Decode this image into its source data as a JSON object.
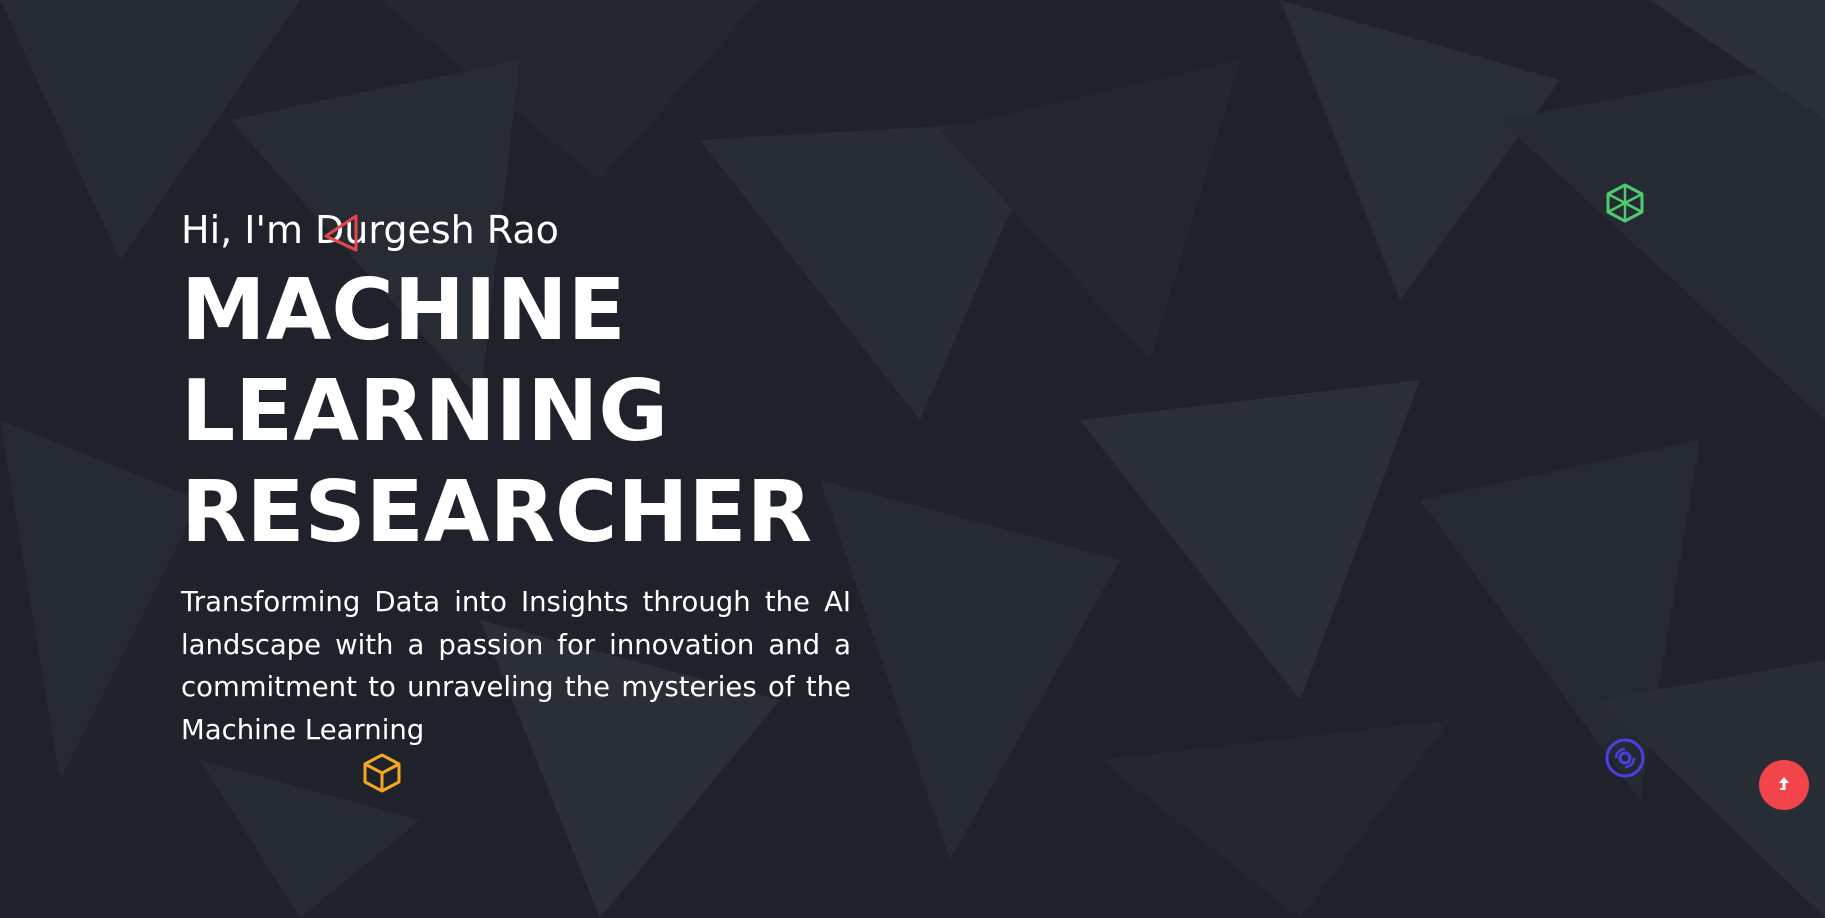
{
  "hero": {
    "greeting": "Hi, I'm Durgesh Rao",
    "title_lines": [
      "MACHINE",
      "LEARNING",
      "RESEARCHER"
    ],
    "tagline": "Transforming Data into Insights through the AI landscape with a passion for innovation and a commitment to unraveling the mysteries of the Machine Learning"
  },
  "decorations": {
    "triangle_color": "#e8454b",
    "cube_green_color": "#4ecb71",
    "cube_orange_color": "#f5a623",
    "disc_color": "#4b3fe6"
  },
  "scroll_top": {
    "icon": "arrow-up-icon",
    "color": "#f2454b"
  },
  "colors": {
    "background": "#1f222b",
    "text": "#ffffff"
  }
}
